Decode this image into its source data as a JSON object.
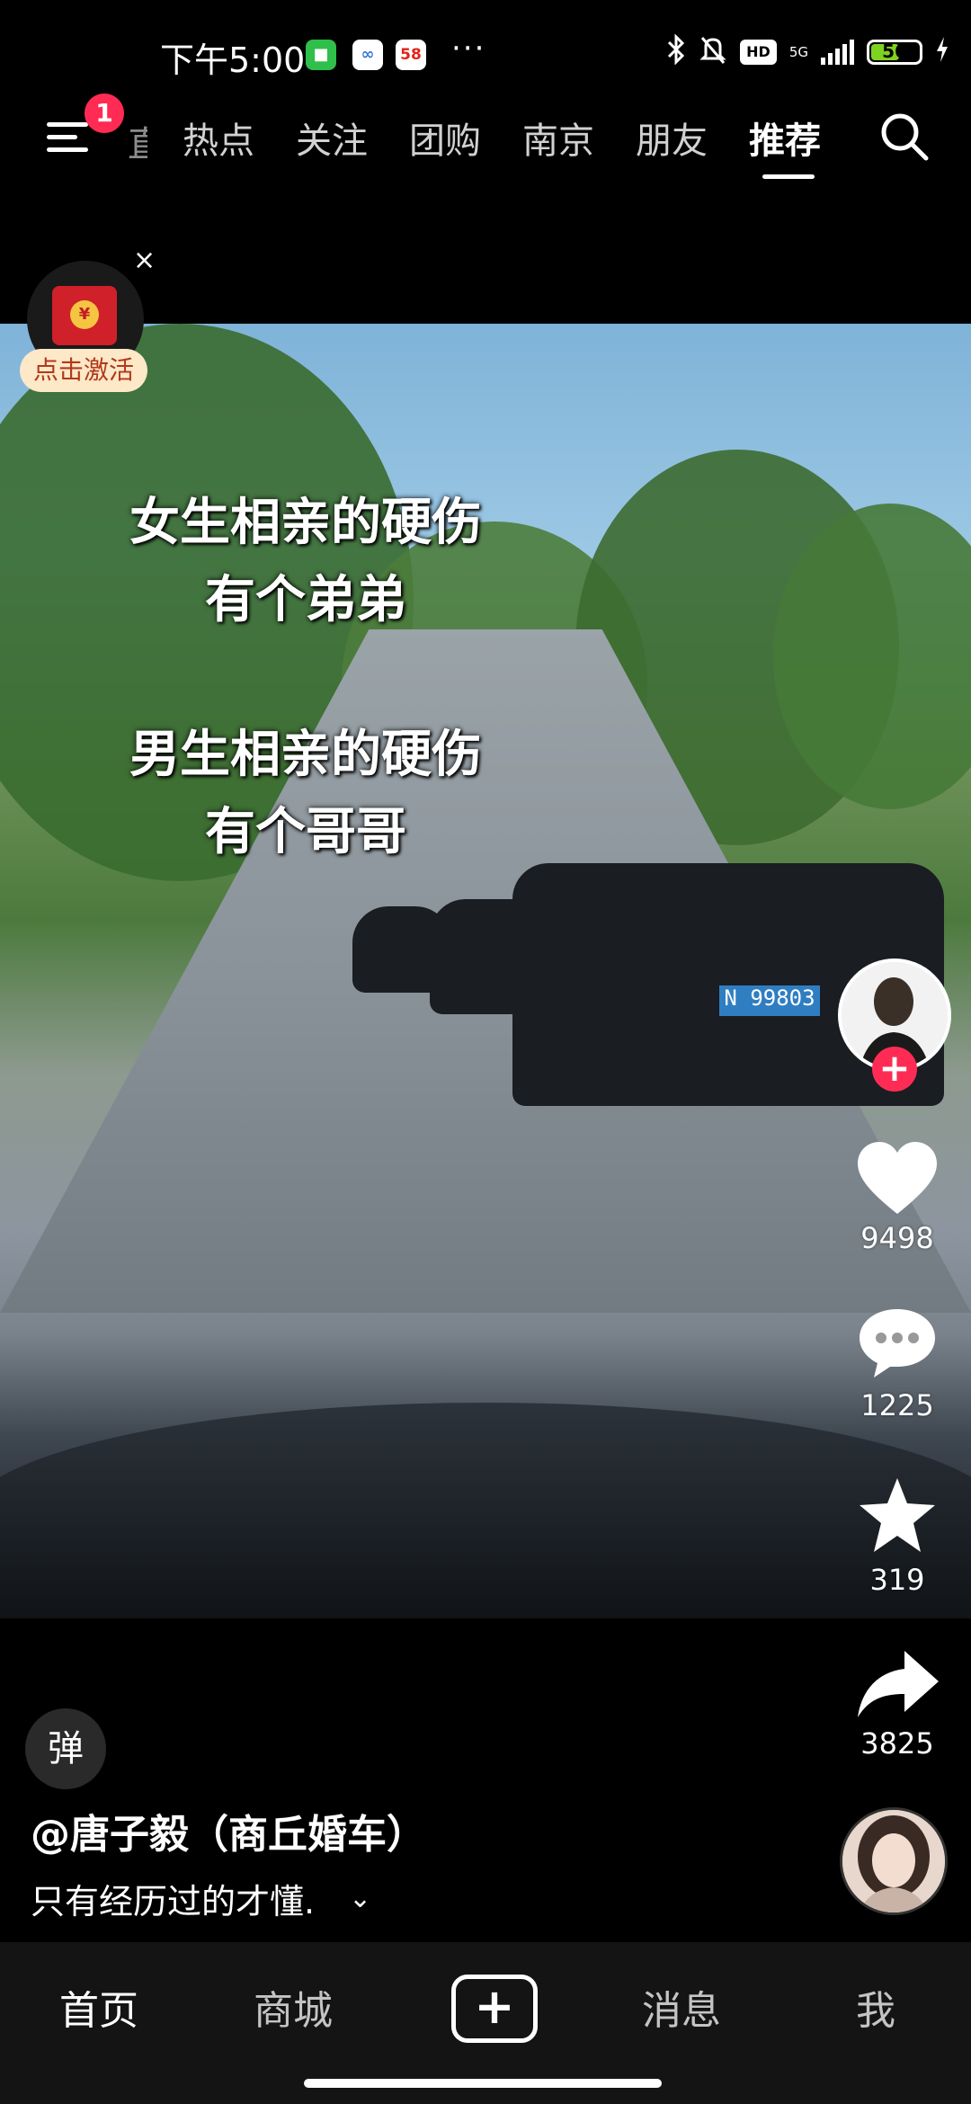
{
  "status_bar": {
    "time": "下午5:00",
    "app_icons": [
      "app-icon-green",
      "app-icon-colorful",
      "58"
    ],
    "more": "···",
    "network": "5G",
    "hd": "HD",
    "battery": "56"
  },
  "top_nav": {
    "badge": "1",
    "partial_tab": "直",
    "tabs": [
      {
        "label": "热点"
      },
      {
        "label": "关注"
      },
      {
        "label": "团购"
      },
      {
        "label": "南京"
      },
      {
        "label": "朋友"
      },
      {
        "label": "推荐",
        "active": true
      }
    ]
  },
  "packet": {
    "close": "×",
    "coin": "¥",
    "label": "点击激活"
  },
  "video": {
    "text_lines": [
      "女生相亲的硬伤",
      "有个弟弟",
      "男生相亲的硬伤",
      "有个哥哥"
    ],
    "plate": "N 99803"
  },
  "actions": {
    "follow": "+",
    "likes": "9498",
    "comments": "1225",
    "favorites": "319",
    "shares": "3825"
  },
  "info": {
    "danmu": "弹",
    "author": "@唐子毅（商丘婚车）",
    "caption": "只有经历过的才懂.",
    "more": "⌄"
  },
  "tabbar": {
    "home": "首页",
    "mall": "商城",
    "create": "+",
    "messages": "消息",
    "me": "我"
  }
}
